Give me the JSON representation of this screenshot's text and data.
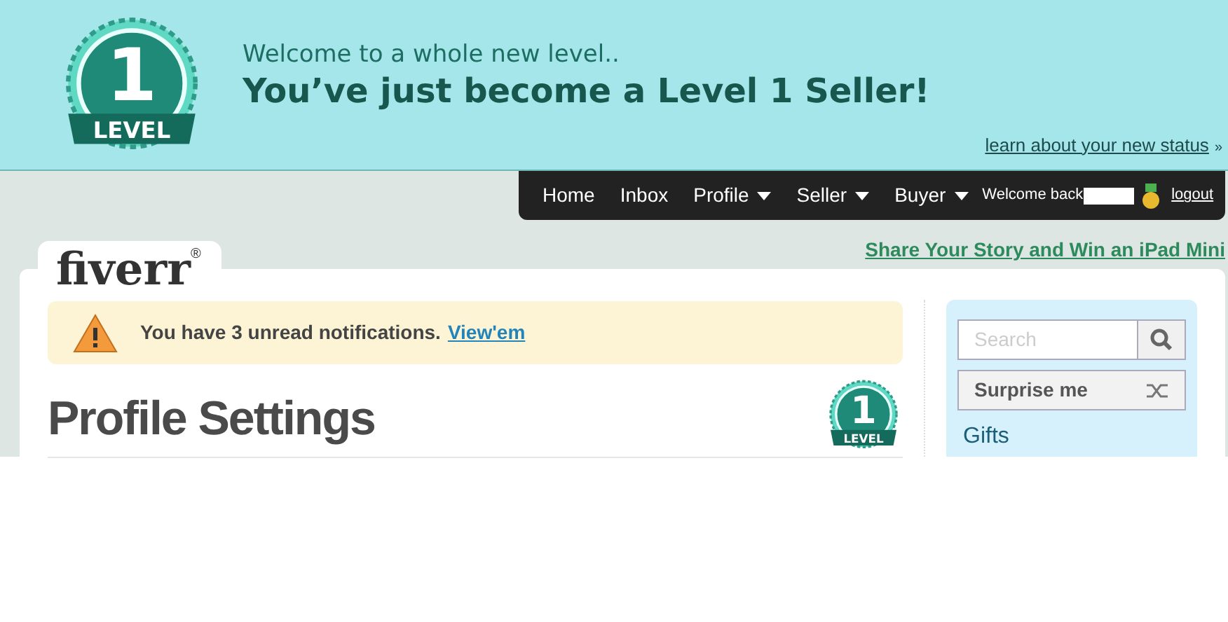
{
  "banner": {
    "badge": {
      "number": "1",
      "label": "LEVEL"
    },
    "subtitle": "Welcome to a whole new level..",
    "title": "You’ve just become a Level 1 Seller!",
    "link": "learn about your new status",
    "link_suffix": "»"
  },
  "nav": {
    "items": [
      {
        "label": "Home",
        "has_menu": false
      },
      {
        "label": "Inbox",
        "has_menu": false
      },
      {
        "label": "Profile",
        "has_menu": true
      },
      {
        "label": "Seller",
        "has_menu": true
      },
      {
        "label": "Buyer",
        "has_menu": true
      }
    ],
    "welcome": "Welcome back",
    "logout": "logout"
  },
  "promo_link": "Share Your Story and Win an iPad Mini",
  "logo": {
    "text": "fiverr",
    "mark": "®"
  },
  "notification": {
    "text": "You have 3 unread notifications.",
    "link": "View'em"
  },
  "page_title": "Profile Settings",
  "level_badge": {
    "number": "1",
    "label": "LEVEL"
  },
  "sidebar": {
    "search_placeholder": "Search",
    "surprise": "Surprise me",
    "items": [
      "Gifts"
    ]
  }
}
